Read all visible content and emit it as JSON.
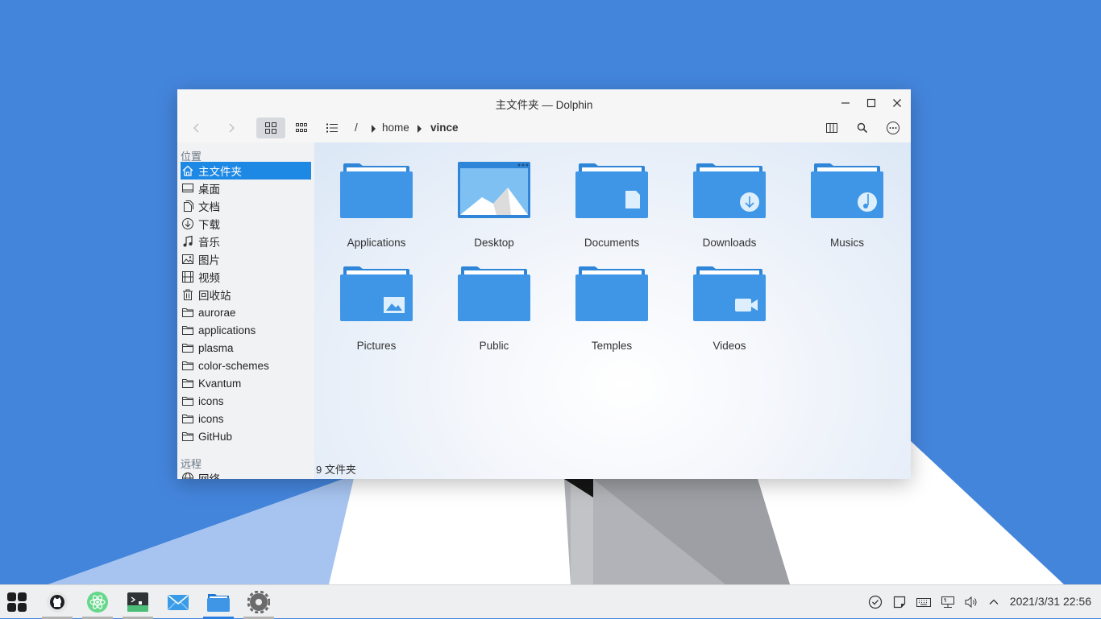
{
  "window": {
    "title": "主文件夹 — Dolphin",
    "breadcrumb": [
      "/",
      "home",
      "vince"
    ]
  },
  "sidebar": {
    "places_header": "位置",
    "remote_header": "远程",
    "items": [
      {
        "label": "主文件夹",
        "icon": "home-icon",
        "selected": true
      },
      {
        "label": "桌面",
        "icon": "desktop-icon"
      },
      {
        "label": "文档",
        "icon": "documents-icon"
      },
      {
        "label": "下载",
        "icon": "download-icon"
      },
      {
        "label": "音乐",
        "icon": "music-icon"
      },
      {
        "label": "图片",
        "icon": "pictures-icon"
      },
      {
        "label": "视频",
        "icon": "video-icon"
      },
      {
        "label": "回收站",
        "icon": "trash-icon"
      },
      {
        "label": "aurorae",
        "icon": "folder-icon"
      },
      {
        "label": "applications",
        "icon": "folder-icon"
      },
      {
        "label": "plasma",
        "icon": "folder-icon"
      },
      {
        "label": "color-schemes",
        "icon": "folder-icon"
      },
      {
        "label": "Kvantum",
        "icon": "folder-icon"
      },
      {
        "label": "icons",
        "icon": "folder-icon"
      },
      {
        "label": "icons",
        "icon": "folder-icon"
      },
      {
        "label": "GitHub",
        "icon": "folder-icon"
      }
    ],
    "remote_items": [
      {
        "label": "网络",
        "icon": "network-icon"
      }
    ]
  },
  "files": [
    {
      "name": "Applications",
      "icon": "folder-icon"
    },
    {
      "name": "Desktop",
      "icon": "desktop-folder-icon"
    },
    {
      "name": "Documents",
      "icon": "documents-folder-icon"
    },
    {
      "name": "Downloads",
      "icon": "downloads-folder-icon"
    },
    {
      "name": "Musics",
      "icon": "music-folder-icon"
    },
    {
      "name": "Pictures",
      "icon": "pictures-folder-icon"
    },
    {
      "name": "Public",
      "icon": "folder-icon"
    },
    {
      "name": "Temples",
      "icon": "folder-icon"
    },
    {
      "name": "Videos",
      "icon": "videos-folder-icon"
    }
  ],
  "status": "9 文件夹",
  "taskbar": {
    "apps": [
      "github-desktop-icon",
      "atom-icon",
      "terminal-icon",
      "mail-icon",
      "file-manager-icon",
      "settings-icon"
    ],
    "tray": [
      "check-icon",
      "notes-icon",
      "keyboard-icon",
      "network-icon",
      "volume-icon",
      "chevron-up-icon"
    ],
    "clock": "2021/3/31 22:56"
  },
  "colors": {
    "accent": "#1e88e5",
    "wallpaper": "#4485dc",
    "folder": "#3f96e6"
  }
}
